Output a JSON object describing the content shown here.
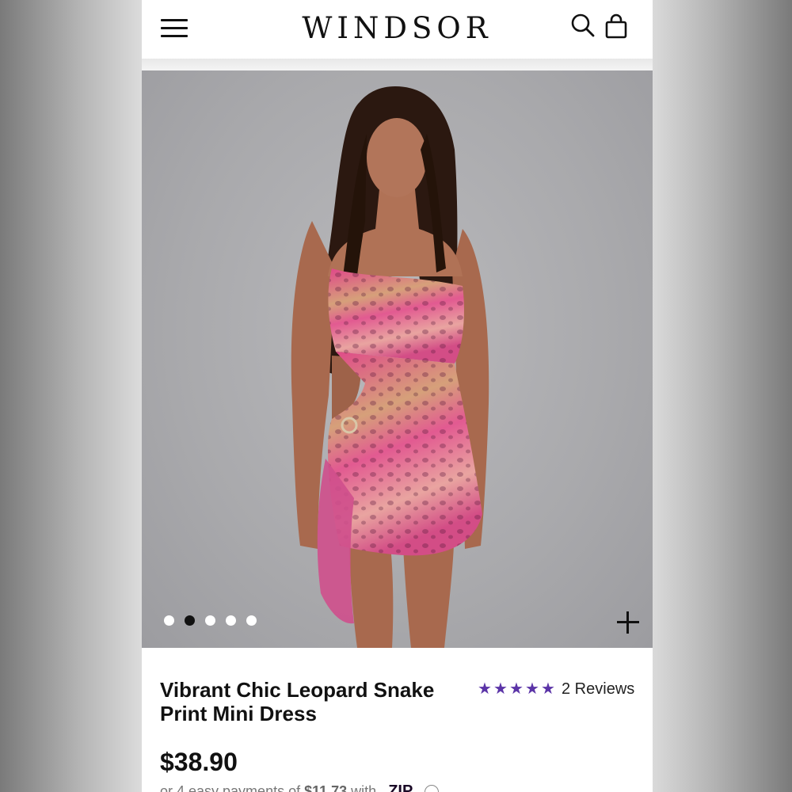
{
  "header": {
    "brand": "WINDSOR",
    "menu_icon": "hamburger-menu-icon",
    "search_icon": "search-icon",
    "bag_icon": "shopping-bag-icon"
  },
  "gallery": {
    "total_images": 5,
    "active_index": 1,
    "zoom_icon": "plus-icon"
  },
  "product": {
    "title": "Vibrant Chic Leopard Snake Print Mini Dress",
    "rating": 5,
    "reviews_label": "2 Reviews",
    "price": "$38.90",
    "installments_prefix": "or 4 easy payments of ",
    "installments_amount": "$11.73",
    "installments_suffix": " with",
    "payment_provider": "ZIP"
  },
  "colors": {
    "star": "#5b34a7",
    "text": "#111111",
    "background": "#ffffff"
  }
}
